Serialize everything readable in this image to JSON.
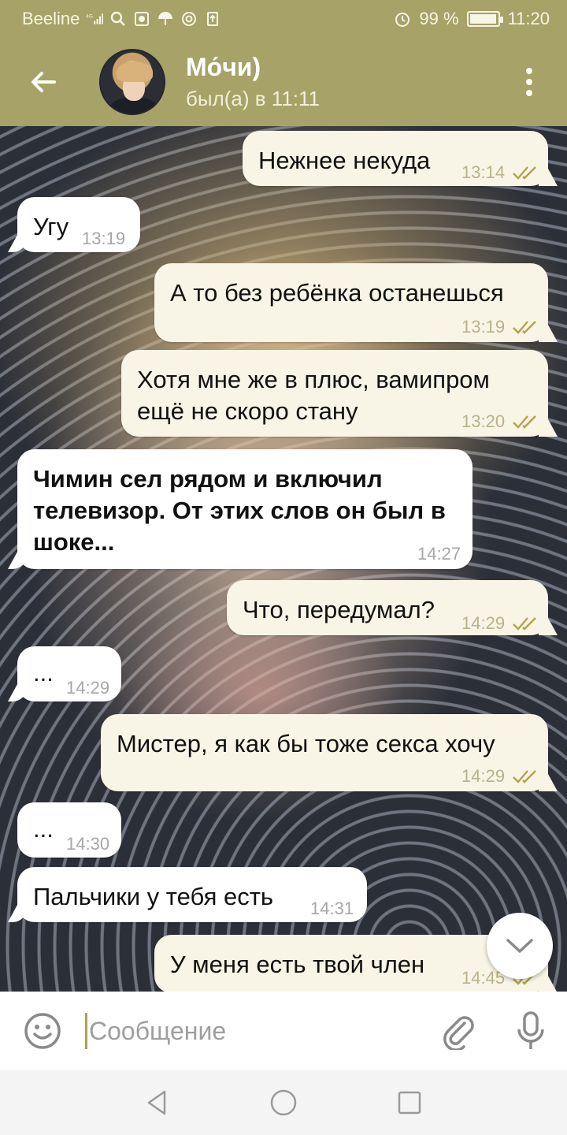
{
  "status_bar": {
    "carrier": "Beeline",
    "network": "4G",
    "battery_text": "99 %",
    "battery_level": 0.99,
    "time": "11:20",
    "icons": [
      "signal-icon",
      "search-icon",
      "gallery-icon",
      "umbrella-icon",
      "at-icon",
      "download-icon",
      "alarm-icon",
      "battery-icon"
    ]
  },
  "header": {
    "back_icon": "back-arrow-icon",
    "chat_name": "Мо́чи)",
    "status": "был(а) в 11:11",
    "menu_icon": "more-vertical-icon"
  },
  "messages": [
    {
      "direction": "out",
      "text": "Нежнее некуда",
      "time": "13:14",
      "read": true
    },
    {
      "direction": "in",
      "text": "Угу",
      "time": "13:19"
    },
    {
      "direction": "out",
      "text": "А то без ребёнка останешься",
      "time": "13:19",
      "read": true
    },
    {
      "direction": "out",
      "text": "Хотя мне же в плюс, вамипром ещё не скоро стану",
      "time": "13:20",
      "read": true
    },
    {
      "direction": "in",
      "text": "Чимин сел рядом и включил телевизор. От этих слов он был в шоке...",
      "time": "14:27"
    },
    {
      "direction": "out",
      "text": "Что, передумал?",
      "time": "14:29",
      "read": true
    },
    {
      "direction": "in",
      "text": "...",
      "time": "14:29"
    },
    {
      "direction": "out",
      "text": "Мистер, я как бы тоже секса хочу",
      "time": "14:29",
      "read": true
    },
    {
      "direction": "in",
      "text": "...",
      "time": "14:30"
    },
    {
      "direction": "in",
      "text": "Пальчики у тебя есть",
      "time": "14:31"
    },
    {
      "direction": "out",
      "text": "У меня есть твой член",
      "time": "14:45",
      "read": true
    }
  ],
  "input": {
    "placeholder": "Сообщение",
    "value": "",
    "emoji_icon": "emoji-icon",
    "attach_icon": "paperclip-icon",
    "mic_icon": "microphone-icon"
  },
  "scroll_button_icon": "chevron-down-icon",
  "nav": {
    "back": "nav-back-icon",
    "home": "nav-home-icon",
    "recents": "nav-recents-icon"
  },
  "colors": {
    "header": "#a7a267",
    "outgoing_bubble": "#f8f5e6",
    "incoming_bubble": "#ffffff",
    "read_check": "#b3a34c"
  }
}
